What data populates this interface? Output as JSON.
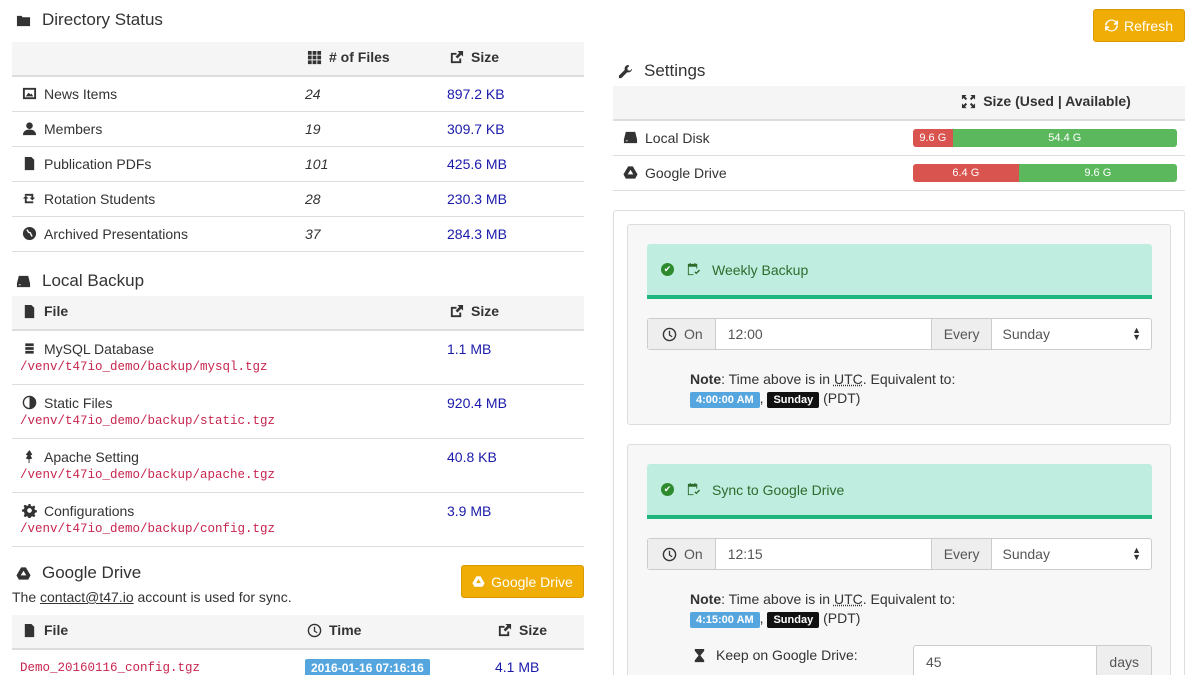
{
  "refresh_label": "Refresh",
  "directory": {
    "title": "Directory Status",
    "col_files": "# of Files",
    "col_size": "Size",
    "rows": [
      {
        "icon": "image-icon",
        "label": "News Items",
        "files": "24",
        "size": "897.2 KB"
      },
      {
        "icon": "user-icon",
        "label": "Members",
        "files": "19",
        "size": "309.7 KB"
      },
      {
        "icon": "file-icon",
        "label": "Publication PDFs",
        "files": "101",
        "size": "425.6 MB"
      },
      {
        "icon": "retweet-icon",
        "label": "Rotation Students",
        "files": "28",
        "size": "230.3 MB"
      },
      {
        "icon": "globe-icon",
        "label": "Archived Presentations",
        "files": "37",
        "size": "284.3 MB"
      }
    ]
  },
  "local_backup": {
    "title": "Local Backup",
    "col_file": "File",
    "col_size": "Size",
    "rows": [
      {
        "icon": "database-icon",
        "label": "MySQL Database",
        "path": "/venv/t47io_demo/backup/mysql.tgz",
        "size": "1.1 MB"
      },
      {
        "icon": "contrast-icon",
        "label": "Static Files",
        "path": "/venv/t47io_demo/backup/static.tgz",
        "size": "920.4 MB"
      },
      {
        "icon": "feather-icon",
        "label": "Apache Setting",
        "path": "/venv/t47io_demo/backup/apache.tgz",
        "size": "40.8 KB"
      },
      {
        "icon": "gear-icon",
        "label": "Configurations",
        "path": "/venv/t47io_demo/backup/config.tgz",
        "size": "3.9 MB"
      }
    ]
  },
  "google_drive": {
    "title": "Google Drive",
    "button": "Google Drive",
    "desc_pre": "The",
    "account": "contact@t47.io",
    "desc_post": "account is used for sync.",
    "col_file": "File",
    "col_time": "Time",
    "col_size": "Size",
    "rows": [
      {
        "file": "Demo_20160116_config.tgz",
        "time": "2016-01-16 07:16:16",
        "size": "4.1 MB"
      }
    ]
  },
  "settings": {
    "title": "Settings",
    "col_size": "Size (Used | Available)",
    "disks": [
      {
        "icon": "hdd-icon",
        "label": "Local Disk",
        "used": "9.6 G",
        "available": "54.4 G",
        "used_fraction": 0.15
      },
      {
        "icon": "drive-icon",
        "label": "Google Drive",
        "used": "6.4 G",
        "available": "9.6 G",
        "used_fraction": 0.4
      }
    ]
  },
  "weekly_backup": {
    "title": "Weekly Backup",
    "on_label": "On",
    "time": "12:00",
    "every_label": "Every",
    "day": "Sunday",
    "note_label": "Note",
    "note_text": ": Time above is in",
    "utc": "UTC",
    "note_tail": ". Equivalent to:",
    "local_time": "4:00:00 AM",
    "local_day": "Sunday",
    "tz": "(PDT)"
  },
  "sync_drive": {
    "title": "Sync to Google Drive",
    "on_label": "On",
    "time": "12:15",
    "every_label": "Every",
    "day": "Sunday",
    "note_label": "Note",
    "note_text": ": Time above is in",
    "utc": "UTC",
    "note_tail": ". Equivalent to:",
    "local_time": "4:15:00 AM",
    "local_day": "Sunday",
    "tz": "(PDT)",
    "keep_label": "Keep on Google Drive:",
    "keep_value": "45",
    "keep_unit": "days"
  },
  "colors": {
    "warning": "#f0ad05",
    "success": "#5cb85c",
    "danger": "#d9534f",
    "alert_bg": "#bfeee0",
    "link": "#1a1aaa",
    "code": "#c7254e"
  }
}
